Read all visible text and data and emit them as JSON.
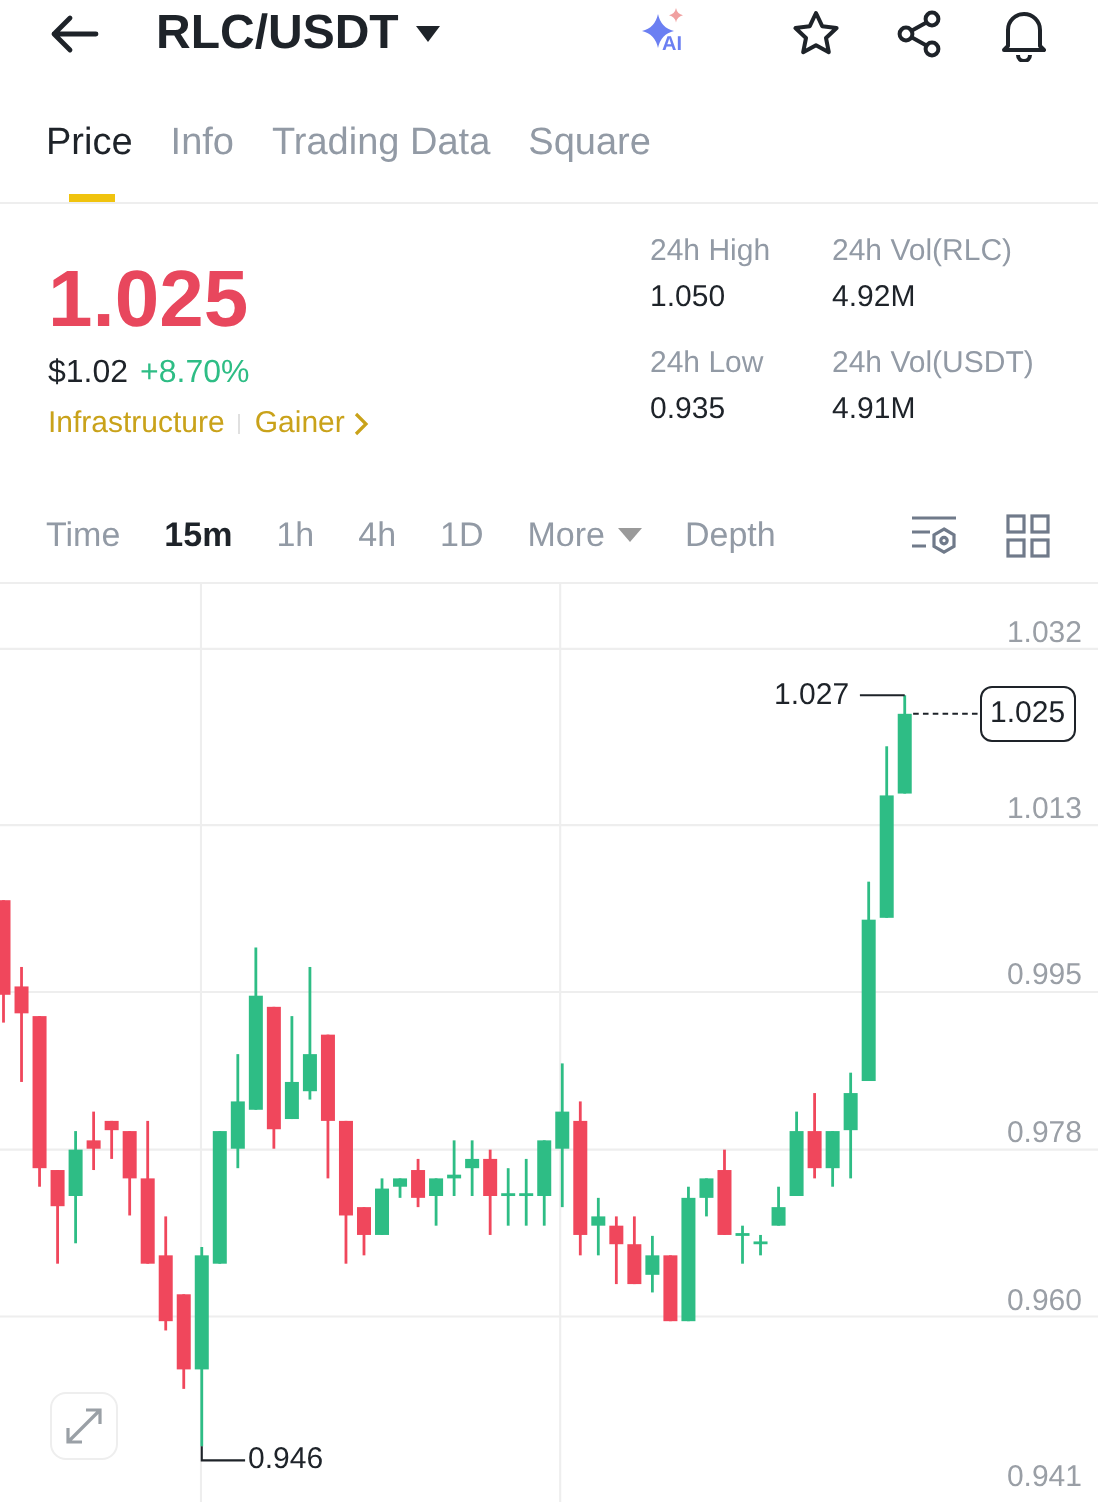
{
  "header": {
    "title": "RLC/USDT",
    "ai_label": "AI"
  },
  "tabs": [
    {
      "label": "Price",
      "selected": true
    },
    {
      "label": "Info",
      "selected": false
    },
    {
      "label": "Trading Data",
      "selected": false
    },
    {
      "label": "Square",
      "selected": false
    }
  ],
  "ticker": {
    "last_price": "1.025",
    "usd_price": "$1.02",
    "change": "+8.70%",
    "tags": [
      {
        "label": "Infrastructure",
        "has_arrow": false
      },
      {
        "label": "Gainer",
        "has_arrow": true
      }
    ]
  },
  "stats": [
    {
      "label": "24h High",
      "value": "1.050"
    },
    {
      "label": "24h Vol(RLC)",
      "value": "4.92M"
    },
    {
      "label": "24h Low",
      "value": "0.935"
    },
    {
      "label": "24h Vol(USDT)",
      "value": "4.91M"
    }
  ],
  "intervals": [
    {
      "label": "Time",
      "kind": "option",
      "selected": false
    },
    {
      "label": "15m",
      "kind": "option",
      "selected": true
    },
    {
      "label": "1h",
      "kind": "option",
      "selected": false
    },
    {
      "label": "4h",
      "kind": "option",
      "selected": false
    },
    {
      "label": "1D",
      "kind": "option",
      "selected": false
    },
    {
      "label": "More",
      "kind": "dropdown",
      "selected": false
    },
    {
      "label": "Depth",
      "kind": "option",
      "selected": false
    }
  ],
  "chart": {
    "high_marker": "1.027",
    "low_marker": "0.946",
    "current_price": "1.025",
    "chart_data": {
      "type": "candlestick",
      "grid": true,
      "ohlc": [
        [
          1.0049,
          1.0049,
          0.9917,
          0.9947
        ],
        [
          0.9956,
          0.9977,
          0.9853,
          0.9927
        ],
        [
          0.9924,
          0.9924,
          0.974,
          0.976
        ],
        [
          0.9758,
          0.9758,
          0.9657,
          0.9719
        ],
        [
          0.973,
          0.98,
          0.9679,
          0.978
        ],
        [
          0.979,
          0.9821,
          0.9758,
          0.9781
        ],
        [
          0.9811,
          0.9811,
          0.977,
          0.9801
        ],
        [
          0.98,
          0.98,
          0.9709,
          0.9749
        ],
        [
          0.9749,
          0.9811,
          0.9657,
          0.9657
        ],
        [
          0.9666,
          0.9708,
          0.9585,
          0.9595
        ],
        [
          0.9624,
          0.9624,
          0.9522,
          0.9543
        ],
        [
          0.9543,
          0.9675,
          0.946,
          0.9666
        ],
        [
          0.9657,
          0.98,
          0.9657,
          0.98
        ],
        [
          0.9781,
          0.9883,
          0.976,
          0.9832
        ],
        [
          0.9823,
          0.9998,
          0.9823,
          0.9946
        ],
        [
          0.9934,
          0.9934,
          0.9781,
          0.9802
        ],
        [
          0.9813,
          0.9924,
          0.9813,
          0.9853
        ],
        [
          0.9843,
          0.9977,
          0.9834,
          0.9883
        ],
        [
          0.9904,
          0.9904,
          0.9749,
          0.9811
        ],
        [
          0.9811,
          0.9811,
          0.9657,
          0.9709
        ],
        [
          0.9718,
          0.9718,
          0.9666,
          0.9688
        ],
        [
          0.9688,
          0.9749,
          0.9688,
          0.9738
        ],
        [
          0.974,
          0.9749,
          0.9728,
          0.9749
        ],
        [
          0.9758,
          0.977,
          0.9718,
          0.9728
        ],
        [
          0.973,
          0.9749,
          0.9698,
          0.9749
        ],
        [
          0.9749,
          0.979,
          0.973,
          0.9753
        ],
        [
          0.976,
          0.979,
          0.973,
          0.977
        ],
        [
          0.977,
          0.978,
          0.9688,
          0.973
        ],
        [
          0.973,
          0.976,
          0.9698,
          0.9733
        ],
        [
          0.973,
          0.977,
          0.9698,
          0.9733
        ],
        [
          0.973,
          0.979,
          0.9698,
          0.979
        ],
        [
          0.9781,
          0.9873,
          0.9718,
          0.9821
        ],
        [
          0.9811,
          0.9832,
          0.9666,
          0.9688
        ],
        [
          0.9698,
          0.9728,
          0.9666,
          0.9708
        ],
        [
          0.9698,
          0.9708,
          0.9635,
          0.9678
        ],
        [
          0.9678,
          0.9708,
          0.9635,
          0.9635
        ],
        [
          0.9645,
          0.9687,
          0.9626,
          0.9666
        ],
        [
          0.9666,
          0.9666,
          0.9595,
          0.9595
        ],
        [
          0.9595,
          0.974,
          0.9595,
          0.9728
        ],
        [
          0.9728,
          0.9749,
          0.9708,
          0.9749
        ],
        [
          0.9758,
          0.978,
          0.9688,
          0.9688
        ],
        [
          0.9687,
          0.9698,
          0.9657,
          0.969
        ],
        [
          0.9678,
          0.9688,
          0.9666,
          0.9681
        ],
        [
          0.9698,
          0.974,
          0.9698,
          0.9718
        ],
        [
          0.973,
          0.9821,
          0.973,
          0.98
        ],
        [
          0.98,
          0.9841,
          0.9749,
          0.976
        ],
        [
          0.976,
          0.98,
          0.974,
          0.98
        ],
        [
          0.9801,
          0.9863,
          0.9749,
          0.9841
        ],
        [
          0.9854,
          1.0069,
          0.9854,
          1.0028
        ],
        [
          1.003,
          1.0215,
          1.003,
          1.0162
        ],
        [
          1.0164,
          1.027,
          1.0164,
          1.025
        ]
      ],
      "ylim": [
        0.94,
        1.039
      ],
      "yticks": [
        {
          "value": 1.032,
          "label": "1.032"
        },
        {
          "value": 1.013,
          "label": "1.013"
        },
        {
          "value": 0.995,
          "label": "0.995"
        },
        {
          "value": 0.978,
          "label": "0.978"
        },
        {
          "value": 0.96,
          "label": "0.960"
        },
        {
          "value": 0.941,
          "label": "0.941"
        }
      ]
    }
  }
}
